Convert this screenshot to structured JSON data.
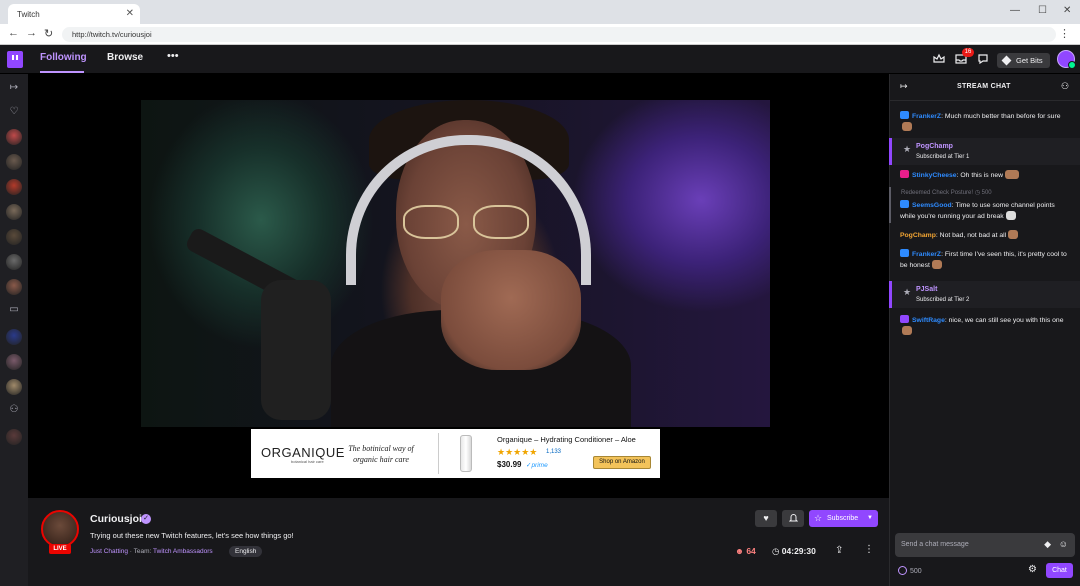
{
  "browser": {
    "tab_title": "Twitch",
    "tab_close": "✕",
    "url": "http://twitch.tv/curiousjoi",
    "back": "←",
    "forward": "→",
    "reload": "↻",
    "minimize": "—",
    "maximize": "☐",
    "close": "✕",
    "menu": "⋮"
  },
  "topnav": {
    "following": "Following",
    "browse": "Browse",
    "more": "•••",
    "notification_count": "16",
    "get_bits": "Get Bits",
    "icons": [
      "crown-icon",
      "inbox-icon",
      "whisper-icon"
    ]
  },
  "sidebar": {
    "collapse_icon": "↦",
    "heart_icon": "♡",
    "camera_icon": "▭",
    "users_icon": "⚇",
    "avatar_colors": [
      "#c04a4a",
      "#6a5a4e",
      "#b33a2a",
      "#7a6a5a",
      "#5a4a3a",
      "#6a6a6a",
      "#8a5a4a",
      "#2a3a8a",
      "#7a5a6a",
      "#a08a6a",
      "#5a3a3a"
    ]
  },
  "ad": {
    "brand": "ORGANIQUE",
    "brand_sub": "botanical hair care",
    "tagline": "The botinical way of organic hair care",
    "product_title": "Organique – Hydrating Conditioner – Aloe",
    "stars": "★★★★★",
    "rating": 4.5,
    "reviews": "1,133",
    "price": "$30.99",
    "prime": "✓prime",
    "button": "Shop on Amazon"
  },
  "stream": {
    "live": "LIVE",
    "channel": "Curiousjoi",
    "verified": "✓",
    "title": "Trying out these new Twitch features, let's see how things go!",
    "category": "Just Chatting",
    "separator": "·",
    "team_label": "Team:",
    "team": "Twitch Ambassadors",
    "language": "English",
    "viewers": "64",
    "uptime": "04:29:30",
    "follow_icon": "♥",
    "notify_icon": "🔔",
    "subscribe": "Subscribe",
    "subscribe_chevron": "▼",
    "viewer_icon": "👤",
    "clock_icon": "◷",
    "share_icon": "⇪",
    "more_icon": "⋮"
  },
  "chat": {
    "title": "STREAM CHAT",
    "collapse_icon": "↦",
    "users_icon": "⚇",
    "messages": [
      {
        "user": "FrankerZ",
        "color": "#2e8bff",
        "text": "Much much better than before for sure"
      },
      {
        "user": "PogChamp",
        "color": "#bf94ff",
        "text": "Subscribed at Tier 1",
        "type": "sub"
      },
      {
        "user": "StinkyCheese",
        "color": "#2e8bff",
        "text": "Oh this is new"
      },
      {
        "redeemed": "Redeemed Check Posture!",
        "points": "500"
      },
      {
        "user": "SeemsGood",
        "color": "#2e8bff",
        "text": "Time to use some channel points while you're running your ad break"
      },
      {
        "user": "PogChamp",
        "color": "#f3a533",
        "text": "Not bad, not bad at all"
      },
      {
        "user": "FrankerZ",
        "color": "#2e8bff",
        "text": "First time I've seen this, it's pretty cool to be honest"
      },
      {
        "user": "PJSalt",
        "color": "#bf94ff",
        "text": "Subscribed at Tier 2",
        "type": "sub"
      },
      {
        "user": "SwiftRage",
        "color": "#2e8bff",
        "text": "nice, we can still see you with this one"
      }
    ],
    "input_placeholder": "Send a chat message",
    "points": "500",
    "chat_button": "Chat",
    "settings_icon": "⚙",
    "bits_icon": "◆",
    "emote_icon": "☺"
  }
}
